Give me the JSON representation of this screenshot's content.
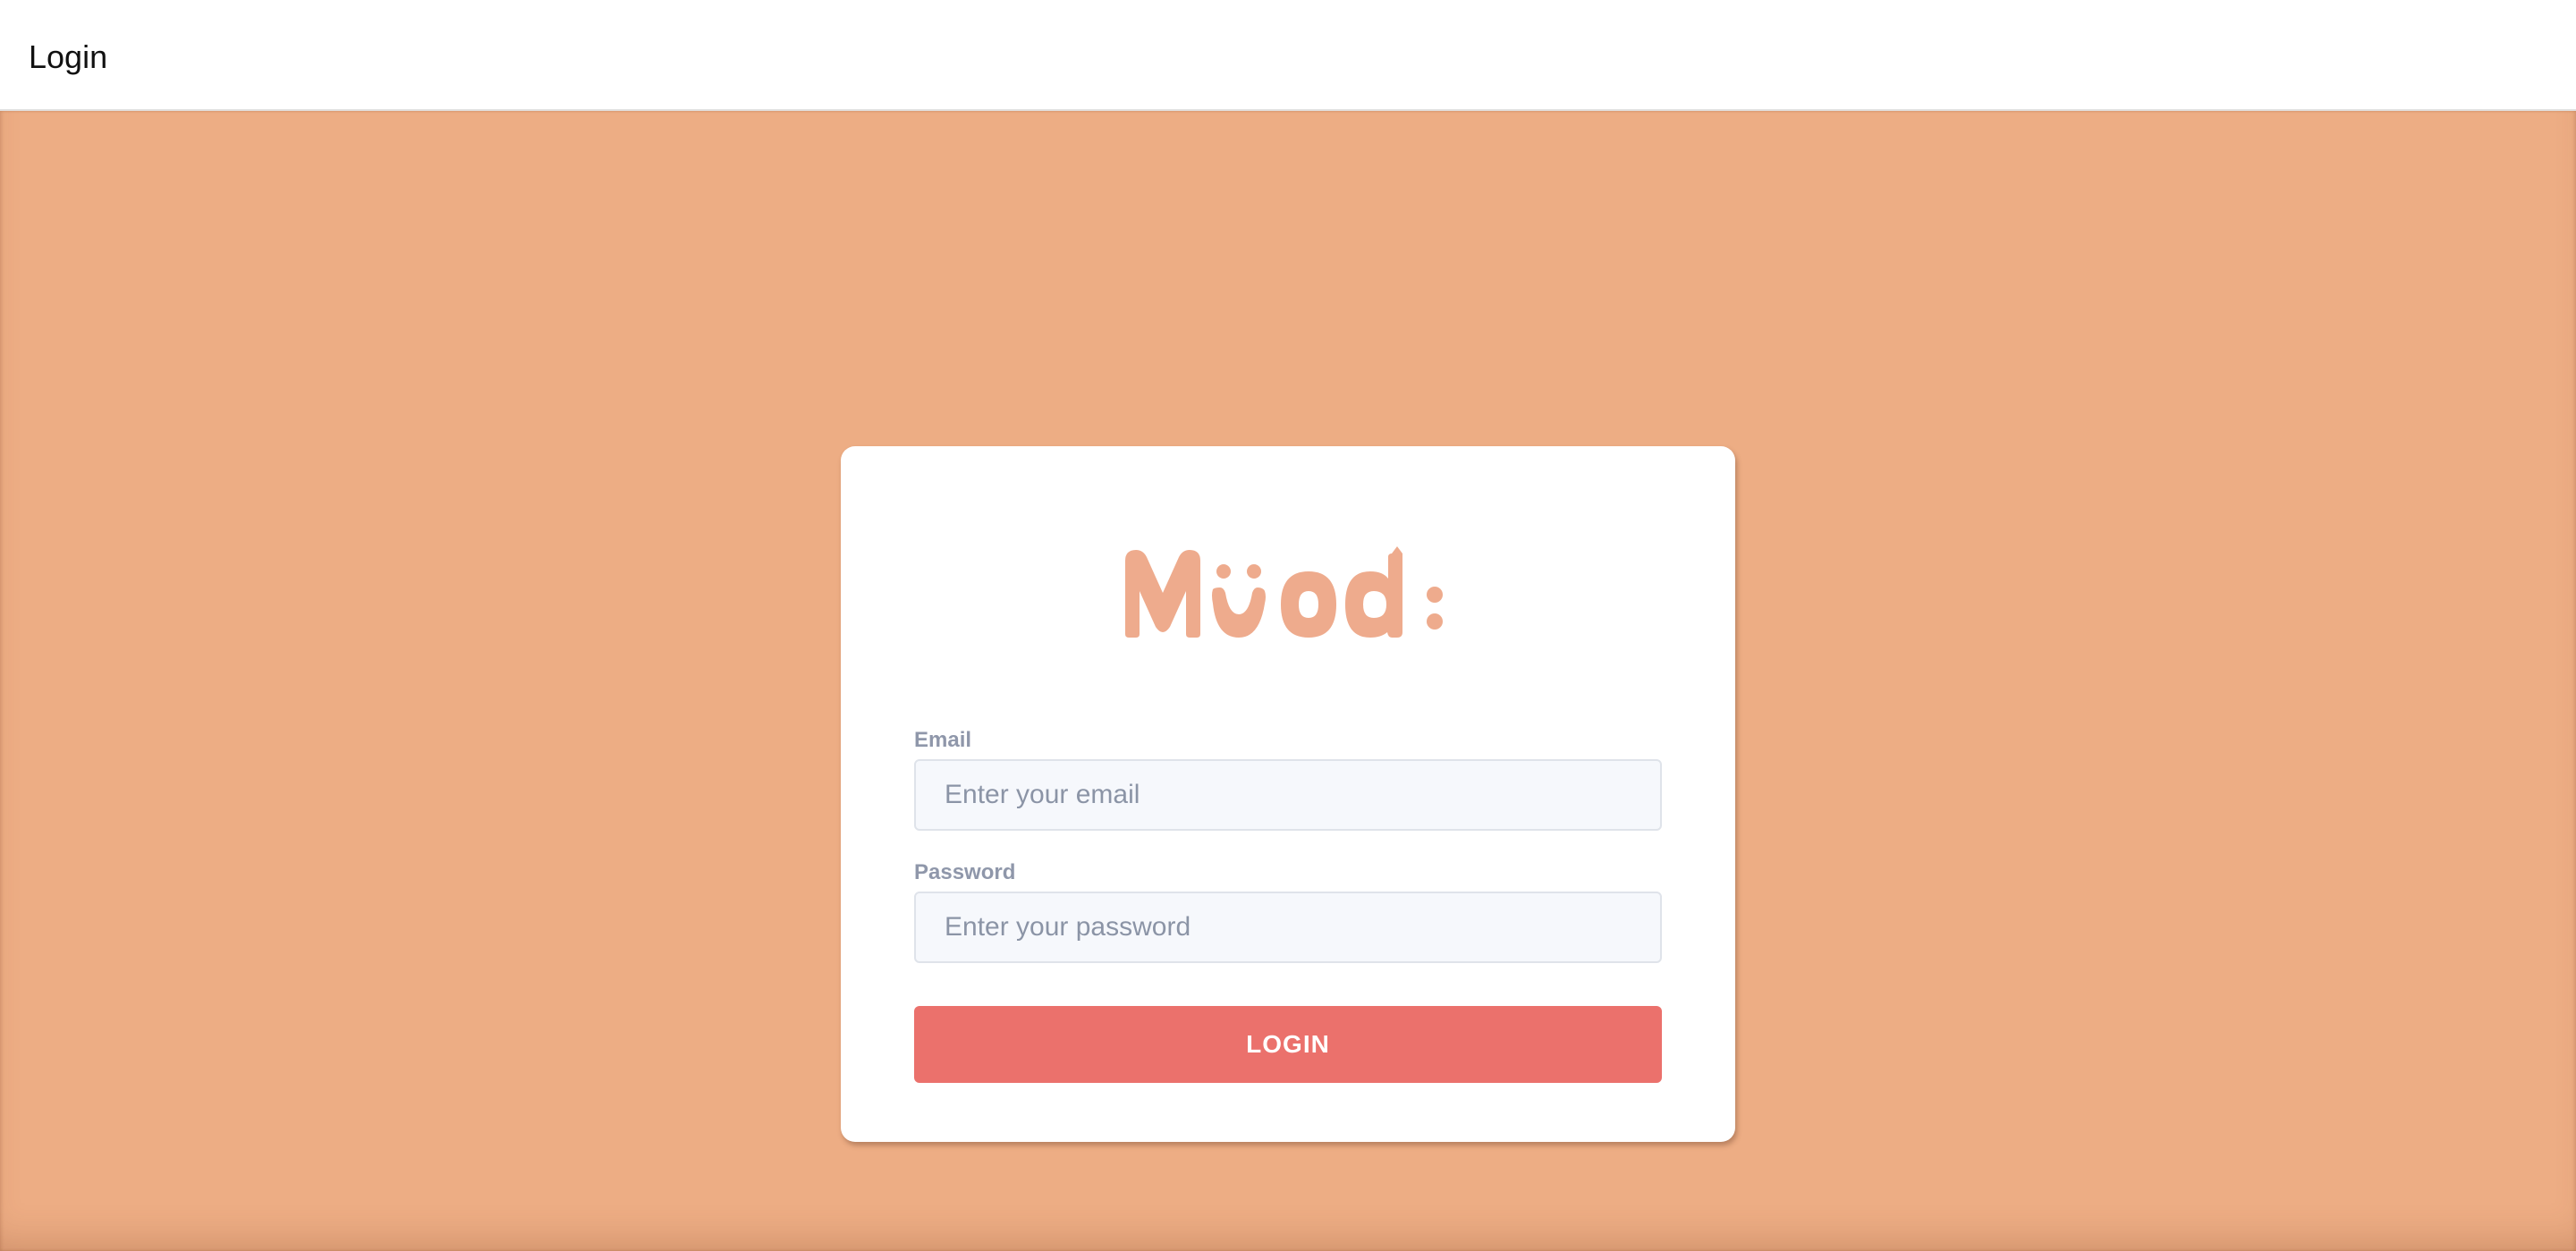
{
  "header": {
    "title": "Login"
  },
  "brand": {
    "logo_text": "Mood:",
    "logo_color": "#eeab8d"
  },
  "form": {
    "email": {
      "label": "Email",
      "placeholder": "Enter your email",
      "value": ""
    },
    "password": {
      "label": "Password",
      "placeholder": "Enter your password",
      "value": ""
    },
    "submit_label": "LOGIN"
  },
  "colors": {
    "page_background": "#edad84",
    "button": "#eb716c",
    "card": "#ffffff"
  }
}
